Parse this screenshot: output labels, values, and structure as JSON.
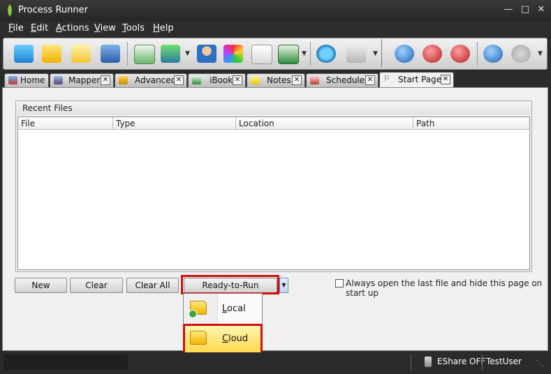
{
  "window": {
    "title": "Process Runner"
  },
  "menu": [
    {
      "u": "F",
      "rest": "ile"
    },
    {
      "u": "E",
      "rest": "dit"
    },
    {
      "u": "A",
      "rest": "ctions"
    },
    {
      "u": "V",
      "rest": "iew"
    },
    {
      "u": "T",
      "rest": "ools"
    },
    {
      "u": "H",
      "rest": "elp"
    }
  ],
  "tabs": [
    {
      "label": "Home",
      "closable": false
    },
    {
      "label": "Mapper",
      "closable": true
    },
    {
      "label": "Advanced",
      "closable": true
    },
    {
      "label": "iBook",
      "closable": true
    },
    {
      "label": "Notes",
      "closable": true
    },
    {
      "label": "Scheduler",
      "closable": true
    },
    {
      "label": "Start Page",
      "closable": true,
      "active": true
    }
  ],
  "recent": {
    "title": "Recent Files",
    "columns": [
      "File",
      "Type",
      "Location",
      "Path"
    ]
  },
  "buttons": {
    "new": "New",
    "clear": "Clear",
    "clear_all": "Clear All",
    "ready_to_run": "Ready-to-Run Template"
  },
  "checkbox": {
    "label": "Always open the last file and hide this page on start up",
    "checked": false
  },
  "dropdown": {
    "items": [
      {
        "u": "L",
        "rest": "ocal"
      },
      {
        "u": "C",
        "rest": "loud",
        "highlighted": true
      }
    ]
  },
  "status": {
    "eshare": "EShare OFF",
    "user": "TestUser"
  },
  "colors": {
    "highlight_border": "#d01010",
    "hover": "#ffd84a",
    "chrome": "#2b2b2b"
  }
}
